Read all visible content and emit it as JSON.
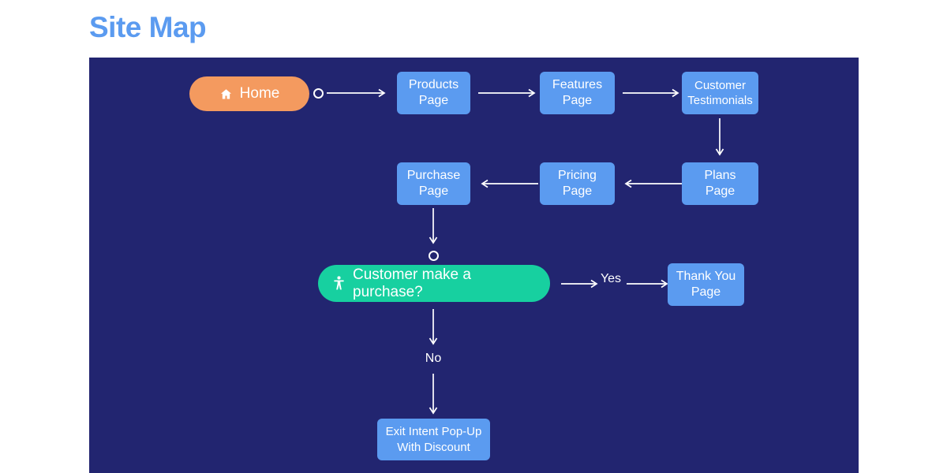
{
  "page": {
    "title": "Site Map",
    "title_color": "#5B9BF0",
    "panel_bg": "#222570",
    "node_color": "#5B9BF0",
    "home_color": "#F49A5F",
    "decision_color": "#17D0A0",
    "edge_color": "#FFFFFF",
    "text_color": "#FFFFFF"
  },
  "diagram": {
    "type": "flowchart",
    "start": {
      "label": "Home",
      "icon": "home-icon",
      "shape": "pill",
      "color": "#F49A5F"
    },
    "decision": {
      "label": "Customer make a purchase?",
      "icon": "person-icon",
      "shape": "pill",
      "color": "#17D0A0"
    },
    "nodes": [
      {
        "id": "products",
        "label_line1": "Products",
        "label_line2": "Page",
        "row": 1
      },
      {
        "id": "features",
        "label_line1": "Features",
        "label_line2": "Page",
        "row": 1
      },
      {
        "id": "testimonials",
        "label_line1": "Customer",
        "label_line2": "Testimonials",
        "row": 1
      },
      {
        "id": "plans",
        "label_line1": "Plans",
        "label_line2": "Page",
        "row": 2
      },
      {
        "id": "pricing",
        "label_line1": "Pricing",
        "label_line2": "Page",
        "row": 2
      },
      {
        "id": "purchase",
        "label_line1": "Purchase",
        "label_line2": "Page",
        "row": 2
      },
      {
        "id": "thankyou",
        "label_line1": "Thank You",
        "label_line2": "Page",
        "row": 3
      },
      {
        "id": "exitintent",
        "label_line1": "Exit Intent Pop-Up",
        "label_line2": "With Discount",
        "row": 4
      }
    ],
    "edge_labels": {
      "yes": "Yes",
      "no": "No"
    },
    "flow": [
      "Home -> Products Page",
      "Products Page -> Features Page",
      "Features Page -> Customer Testimonials",
      "Customer Testimonials -> Plans Page",
      "Plans Page -> Pricing Page",
      "Pricing Page -> Purchase Page",
      "Purchase Page -> Customer make a purchase?",
      "Customer make a purchase? -Yes-> Thank You Page",
      "Customer make a purchase? -No-> Exit Intent Pop-Up With Discount"
    ]
  }
}
